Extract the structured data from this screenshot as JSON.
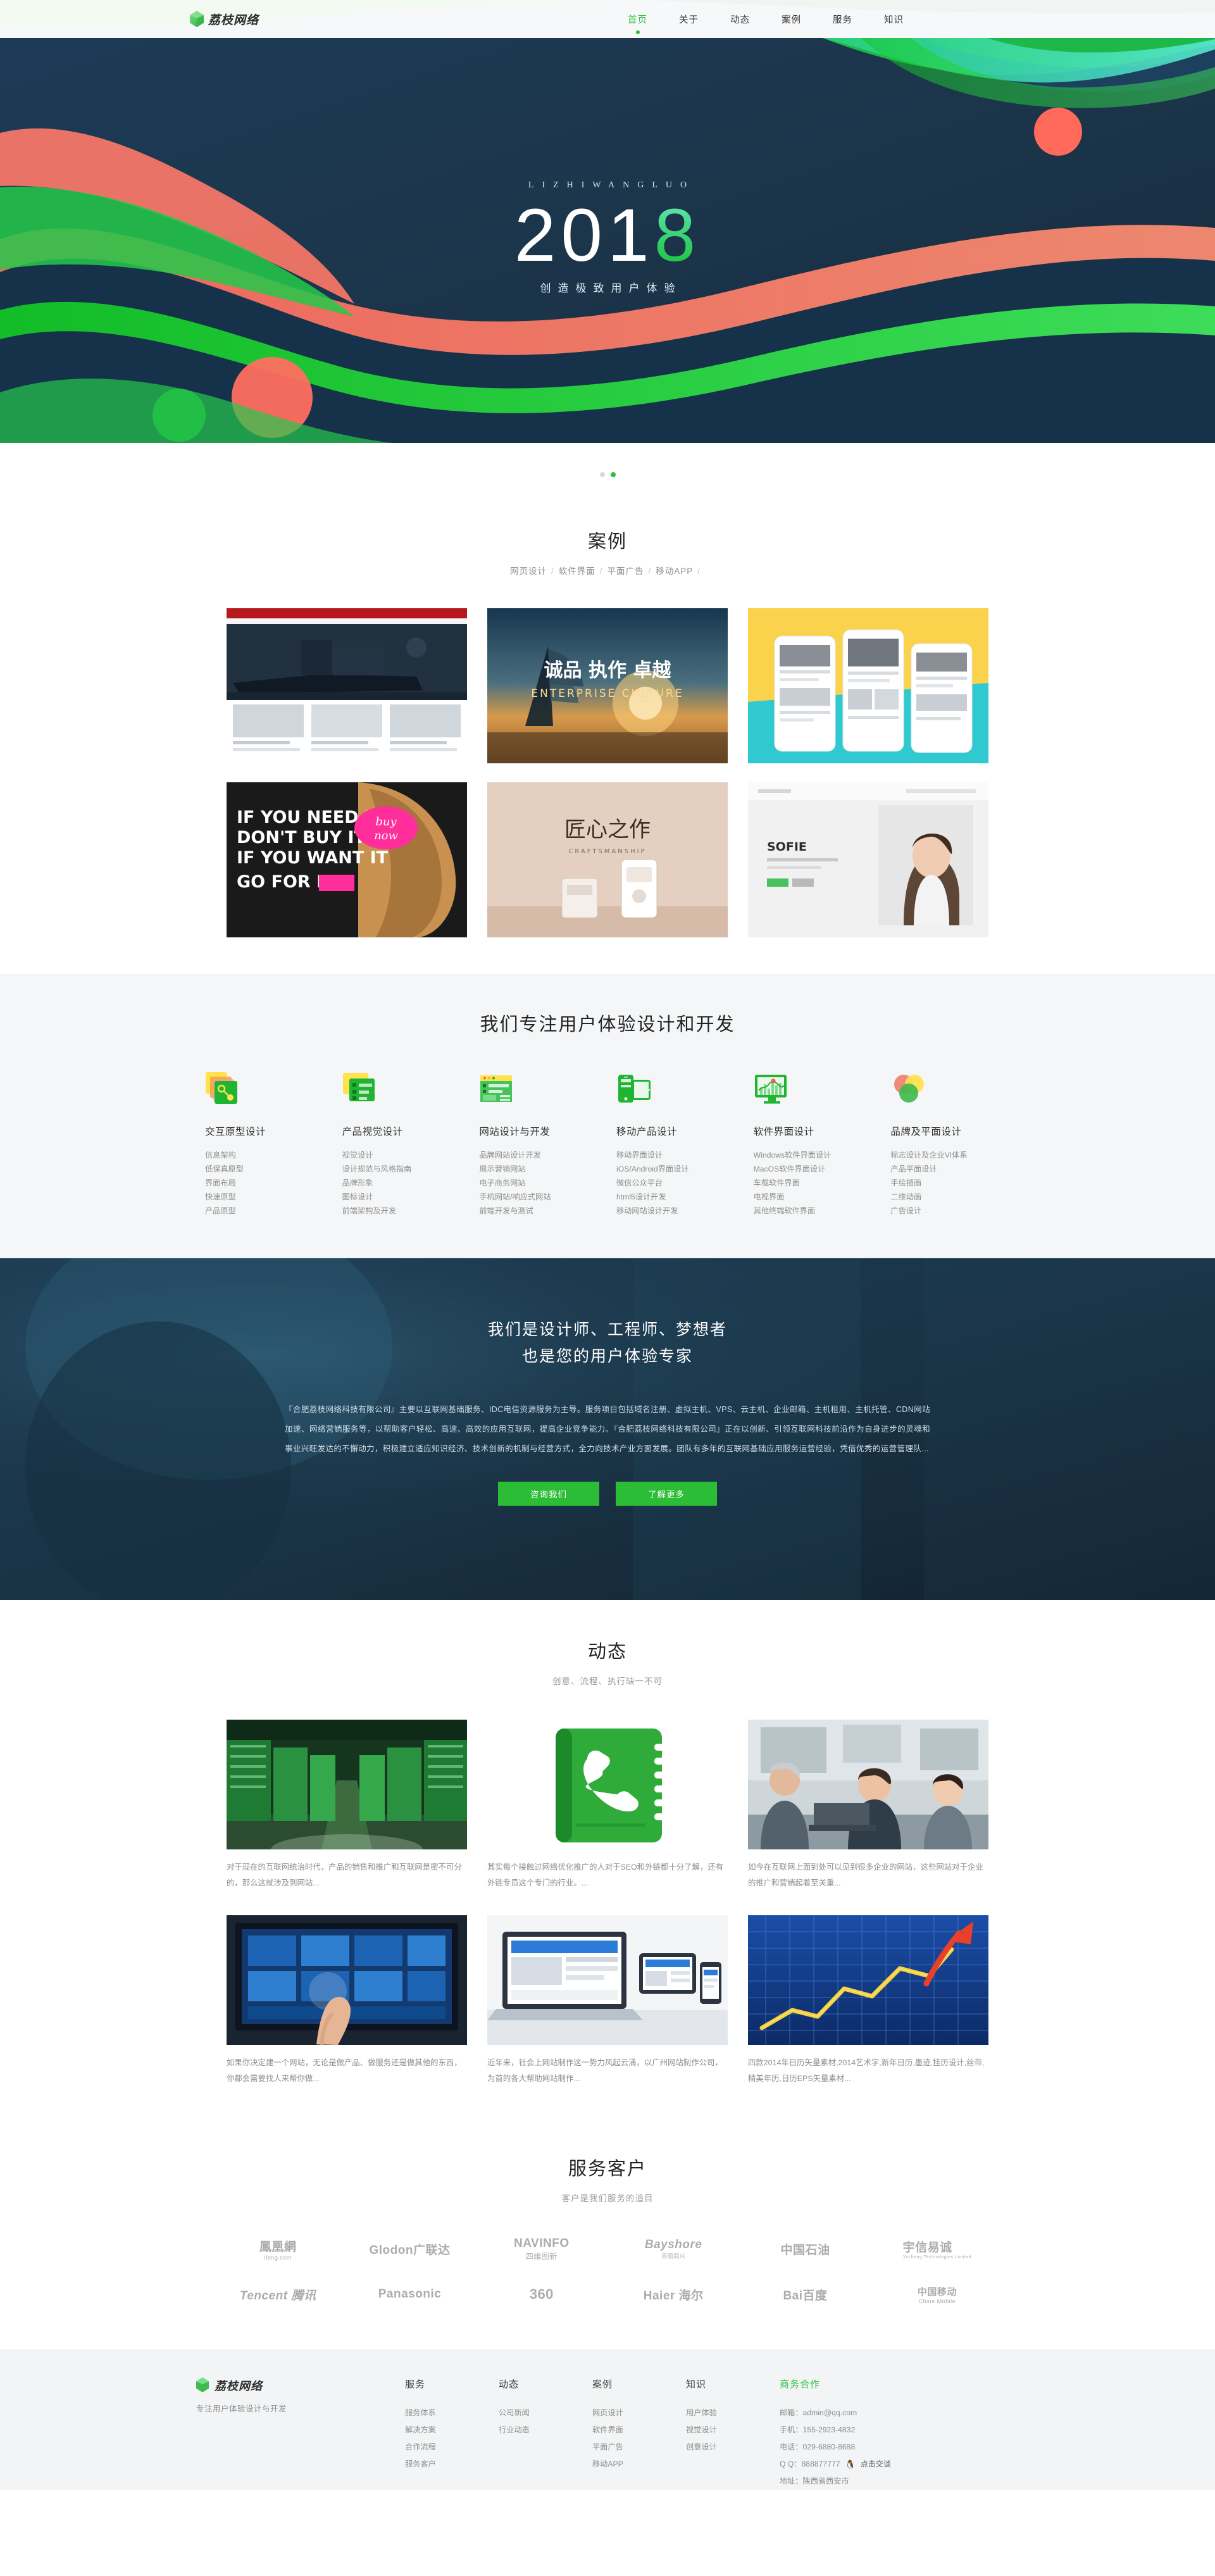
{
  "brand": {
    "name": "荔枝网络",
    "logo_icon": "gem-icon",
    "accent": "#2dbf3f"
  },
  "nav": {
    "items": [
      {
        "label": "首页",
        "active": true
      },
      {
        "label": "关于",
        "active": false
      },
      {
        "label": "动态",
        "active": false
      },
      {
        "label": "案例",
        "active": false
      },
      {
        "label": "服务",
        "active": false
      },
      {
        "label": "知识",
        "active": false
      }
    ]
  },
  "hero": {
    "kicker": "LIZHIWANGLUO",
    "year_white": "201",
    "year_green": "8",
    "subtitle": "创造极致用户体验",
    "dots": [
      {
        "active": false
      },
      {
        "active": true
      }
    ]
  },
  "cases": {
    "title": "案例",
    "filters": [
      "网页设计",
      "软件界面",
      "平面广告",
      "移动APP"
    ],
    "items": [
      {
        "name": "case-ship-news",
        "alt": "货轮新闻门户网站"
      },
      {
        "name": "case-enterprise-culture",
        "alt": "诚品 执作 卓越 筑业 企业文化"
      },
      {
        "name": "case-mobile-app",
        "alt": "移动端APP界面展示"
      },
      {
        "name": "case-hair-poster",
        "alt": "IF YOU NEED IT DON'T BUY IT 海报"
      },
      {
        "name": "case-appliance",
        "alt": "匠心之作 家电产品页"
      },
      {
        "name": "case-sofie-beauty",
        "alt": "SOFIE 美妆电商页"
      }
    ]
  },
  "services": {
    "title": "我们专注用户体验设计和开发",
    "columns": [
      {
        "icon": "layers-prototype-icon",
        "heading": "交互原型设计",
        "items": [
          "信息架构",
          "低保真原型",
          "界面布局",
          "快速原型",
          "产品原型"
        ]
      },
      {
        "icon": "visual-list-icon",
        "heading": "产品视觉设计",
        "items": [
          "视觉设计",
          "设计规范与风格指南",
          "品牌形象",
          "图标设计",
          "前端架构及开发"
        ]
      },
      {
        "icon": "browser-window-icon",
        "heading": "网站设计与开发",
        "items": [
          "品牌网站设计开发",
          "展示营销网站",
          "电子商务网站",
          "手机网站/响应式网站",
          "前端开发与测试"
        ]
      },
      {
        "icon": "mobile-devices-icon",
        "heading": "移动产品设计",
        "items": [
          "移动界面设计",
          "iOS/Android界面设计",
          "微信公众平台",
          "html5设计开发",
          "移动网站设计开发"
        ]
      },
      {
        "icon": "monitor-chart-icon",
        "heading": "软件界面设计",
        "items": [
          "Windows软件界面设计",
          "MacOS软件界面设计",
          "车载软件界面",
          "电视界面",
          "其他终端软件界面"
        ]
      },
      {
        "icon": "venn-circles-icon",
        "heading": "品牌及平面设计",
        "items": [
          "标志设计及企业VI体系",
          "产品平面设计",
          "手绘插画",
          "二维动画",
          "广告设计"
        ]
      }
    ]
  },
  "about": {
    "heading_line1": "我们是设计师、工程师、梦想者",
    "heading_line2": "也是您的用户体验专家",
    "paragraph": "『合肥荔枝网络科技有限公司』主要以互联网基础服务、IDC电信资源服务为主导。服务项目包括域名注册、虚拟主机、VPS、云主机、企业邮箱、主机租用、主机托管、CDN网站加速、网络营销服务等，以帮助客户轻松、高速、高效的应用互联网，提高企业竞争能力。『合肥荔枝网络科技有限公司』正在以创新、引领互联网科技前沿作为自身进步的灵魂和事业兴旺发达的不懈动力，积极建立适应知识经济、技术创新的机制与经营方式，全力向技术产业方面发展。团队有多年的互联网基础应用服务运营经验，凭借优秀的运营管理队...",
    "btn_primary": "咨询我们",
    "btn_secondary": "了解更多"
  },
  "news": {
    "title": "动态",
    "subtitle": "创意、流程、执行缺一不可",
    "items": [
      {
        "thumb": "news-datacenter",
        "alt": "绿色数据中心机房走廊",
        "text": "对于现在的互联网统治时代，产品的销售和推广和互联网是密不可分的，那么这就涉及到网站..."
      },
      {
        "thumb": "news-phonebook-app",
        "alt": "绿色通讯录APP图标",
        "text": "其实每个接触过网络优化推广的人对于SEO和外链都十分了解，还有外链专员这个专门的行业。..."
      },
      {
        "thumb": "news-office-team",
        "alt": "办公室团队协作场景",
        "text": "如今在互联网上面到处可以见到很多企业的网站，这些网站对于企业的推广和营销起着至关重..."
      },
      {
        "thumb": "news-touchscreen",
        "alt": "手指触摸智能电视界面",
        "text": "如果你决定建一个网站，无论是做产品、做服务还是做其他的东西，你都会需要找人来帮你做..."
      },
      {
        "thumb": "news-responsive-devices",
        "alt": "响应式多终端设备展示",
        "text": "近年来，社会上网站制作这一势力风起云涌，以广州网站制作公司，为首的各大帮助网站制作..."
      },
      {
        "thumb": "news-growth-chart",
        "alt": "蓝色网格上升箭头增长图",
        "text": "四款2014年日历矢量素材,2014艺术字,新年日历,墨迹,挂历设计,丝带,精美年历,日历EPS矢量素材..."
      }
    ]
  },
  "clients": {
    "title": "服务客户",
    "subtitle": "客户是我们服务的追目",
    "logos": [
      {
        "name": "ifeng",
        "main": "鳳凰網",
        "sub": "ifeng.com"
      },
      {
        "name": "glodon",
        "main": "Glodon广联达",
        "sub": ""
      },
      {
        "name": "navinfo",
        "main": "NAVINFO",
        "sub": "四维图新"
      },
      {
        "name": "bayshore",
        "main": "Bayshore",
        "sub": "百硕同兴"
      },
      {
        "name": "sinopec-cnpc",
        "main": "中国石油",
        "sub": ""
      },
      {
        "name": "yucheng",
        "main": "宇信易诚",
        "sub": "Yucheng Technologies Limited"
      },
      {
        "name": "tencent",
        "main": "Tencent 腾讯",
        "sub": ""
      },
      {
        "name": "panasonic",
        "main": "Panasonic",
        "sub": ""
      },
      {
        "name": "qihoo-360",
        "main": "360",
        "sub": ""
      },
      {
        "name": "haier",
        "main": "Haier 海尔",
        "sub": ""
      },
      {
        "name": "baidu",
        "main": "Bai百度",
        "sub": ""
      },
      {
        "name": "china-mobile",
        "main": "中国移动",
        "sub": "China Mobile"
      }
    ]
  },
  "footer": {
    "brand_name": "荔枝网络",
    "slogan": "专注用户体验设计与开发",
    "columns": [
      {
        "heading": "服务",
        "green": false,
        "items": [
          "服务体系",
          "解决方案",
          "合作流程",
          "服务客户"
        ]
      },
      {
        "heading": "动态",
        "green": false,
        "items": [
          "公司新闻",
          "行业动态"
        ]
      },
      {
        "heading": "案例",
        "green": false,
        "items": [
          "网页设计",
          "软件界面",
          "平面广告",
          "移动APP"
        ]
      },
      {
        "heading": "知识",
        "green": false,
        "items": [
          "用户体验",
          "视觉设计",
          "创意设计"
        ]
      }
    ],
    "business": {
      "heading": "商务合作",
      "email": "邮箱：admin@qq.com",
      "mobile": "手机：155-2923-4832",
      "phone": "电话：029-6880-8688",
      "qq": "Q Q：888877777",
      "qq_chat": "点击交谈",
      "address": "地址：陕西省西安市"
    }
  }
}
